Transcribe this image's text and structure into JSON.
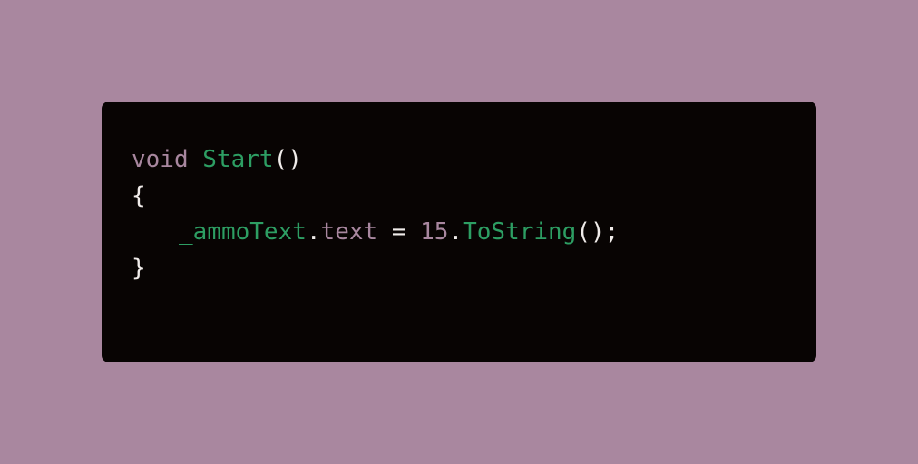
{
  "code": {
    "line1": {
      "keyword": "void",
      "space": " ",
      "function_name": "Start",
      "parens": "()"
    },
    "line2": {
      "brace": "{"
    },
    "line3": {
      "identifier": "_ammoText",
      "dot1": ".",
      "property": "text",
      "assign": " = ",
      "number": "15",
      "dot2": ".",
      "method": "ToString",
      "call_end": "();"
    },
    "line4": {
      "brace": "}"
    }
  },
  "colors": {
    "page_background": "#a9879f",
    "card_background": "#080403",
    "keyword": "#a8879f",
    "function": "#2d9e63",
    "punctuation": "#f0ecea"
  }
}
